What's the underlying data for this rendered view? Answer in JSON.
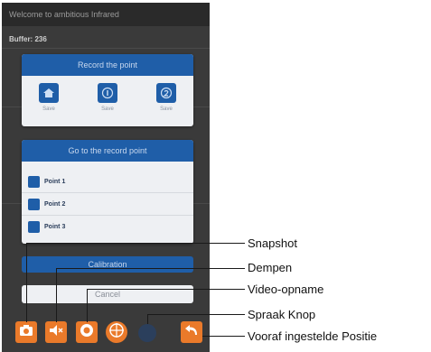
{
  "app": {
    "header_title": "Welcome to ambitious Infrared",
    "subtitle": "Buffer: 236"
  },
  "record_dialog": {
    "title": "Record the point",
    "items": [
      {
        "label": "Save",
        "icon": "home-icon"
      },
      {
        "label": "Save",
        "icon": "number-one-icon"
      },
      {
        "label": "Save",
        "icon": "number-two-icon"
      }
    ]
  },
  "goto_dialog": {
    "title": "Go to the record point",
    "points": [
      {
        "label": "Point 1"
      },
      {
        "label": "Point 2"
      },
      {
        "label": "Point 3"
      }
    ]
  },
  "calibration_label": "Calibration",
  "cancel_label": "Cancel",
  "callouts": [
    "Snapshot",
    "Dempen",
    "Video-opname",
    "Spraak Knop",
    "Vooraf ingestelde Positie"
  ],
  "colors": {
    "accent_blue": "#1f5ea8",
    "accent_orange": "#ea7a2a",
    "screen_bg": "#3a3a3a"
  }
}
